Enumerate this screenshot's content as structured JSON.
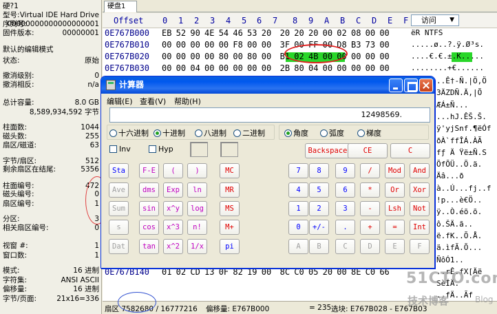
{
  "left_panel": {
    "rows": [
      {
        "label": "硬?1",
        "value": ""
      },
      {
        "label": "型号:",
        "value": "Virtual IDE Hard Drive"
      },
      {
        "label": "序列号:",
        "value": "00000000000000000001"
      },
      {
        "label": "固件版本:",
        "value": "00000001"
      },
      {
        "label": "默认的编辑模式",
        "value": ""
      },
      {
        "label": "状态:",
        "value": "原始"
      },
      {
        "label": "撤消级别:",
        "value": "0"
      },
      {
        "label": "撤消相反:",
        "value": "n/a"
      },
      {
        "label": "总计容量:",
        "value": "8.0 GB"
      },
      {
        "label": "",
        "value": "8,589,934,592 字节"
      },
      {
        "label": "柱面数:",
        "value": "1044"
      },
      {
        "label": "磁头数:",
        "value": "255"
      },
      {
        "label": "扇区/磁道:",
        "value": "63"
      },
      {
        "label": "字节/扇区:",
        "value": "512"
      },
      {
        "label": "剩余扇区在结尾:",
        "value": "5356"
      },
      {
        "label": "柱面编号:",
        "value": "472"
      },
      {
        "label": "磁头编号:",
        "value": "0"
      },
      {
        "label": "扇区编号:",
        "value": "1"
      },
      {
        "label": "分区:",
        "value": "3"
      },
      {
        "label": "相关扇区编号:",
        "value": "0"
      },
      {
        "label": "视窗 #:",
        "value": "1"
      },
      {
        "label": "窗口数:",
        "value": "1"
      },
      {
        "label": "模式:",
        "value": "16 进制"
      },
      {
        "label": "字符集:",
        "value": "ANSI ASCII"
      },
      {
        "label": "偏移量:",
        "value": "16 进制"
      },
      {
        "label": "字节/页面:",
        "value": "21x16=336"
      }
    ]
  },
  "tab": {
    "label": "硬盘1"
  },
  "hex_header": {
    "offset_label": "Offset",
    "columns": [
      "0",
      "1",
      "2",
      "3",
      "4",
      "5",
      "6",
      "7",
      "8",
      "9",
      "A",
      "B",
      "C",
      "D",
      "E",
      "F"
    ],
    "visit_label": "访问"
  },
  "hex_rows": [
    {
      "offset": "0E767B000",
      "bytes": "EB 52 90 4E 54 46 53 20  20 20 20 00 02 08 00 00",
      "ascii": "ëR NTFS"
    },
    {
      "offset": "0E767B010",
      "bytes": "00 00 00 00 00 F8 00 00  3F 00 FF 00 D8 B3 73 00",
      "ascii": ".....ø..?.ÿ.Ø³s."
    },
    {
      "offset": "0E767B020",
      "bytes": "00 00 00 00 80 00 80 00  B1 02 4B 00 00 00 00 00",
      "ascii": "....€.€.±.K....."
    },
    {
      "offset": "0E767B030",
      "bytes": "00 00 04 00 00 00 00 00  2B 80 04 00 00 00 00 00",
      "ascii": "........+€......"
    }
  ],
  "hex_partial_row": {
    "offset": "0E767B140",
    "bytes": "01 02 CD 13 0F 82 19 00  8C C0 05 20 00 8E C0 66"
  },
  "ascii_fragments": [
    "..Ê†-Ñ.|Ö,Ö",
    "3ÄZDÑ.Ä,|Õ",
    "ÆÁ±Ñ...",
    "...hJ.ÊŠ.Š.",
    "ÿ'yjSnf.¶ëÓf",
    "ðÀ`ffÎÁ.ÀÃ",
    "fƒ Ä Ÿë±Ñ.S",
    "ÕfÕÜ..Õ.ä.",
    "Äâ...ð",
    "à..Ú...fj..f",
    "!p...è€Ö..",
    "ÿ..Ò.éõ.õ.",
    "ô.ŠÄ.ã..",
    "ë.fK..Õ.Å.",
    "ä.ìfÃ.Õ...",
    "ÑôÓ1..",
    "..rÊ.fX[Äë",
    "SèÍÄ.",
    "..fÄ..Ãf"
  ],
  "status_bar": {
    "sector": "扇区 7582680 / 16777216",
    "offset": "偏移量: E767B000",
    "value": "= 235",
    "selection": "选块: E767B028 - E767B03"
  },
  "watermark": {
    "big": "51CTO.com",
    "small": "技术博客",
    "blog": "Blog"
  },
  "calculator": {
    "title": "计算器",
    "menu": [
      "编辑(E)",
      "查看(V)",
      "帮助(H)"
    ],
    "display": "12498569.",
    "bases": [
      {
        "label": "十六进制",
        "selected": false
      },
      {
        "label": "十进制",
        "selected": true
      },
      {
        "label": "八进制",
        "selected": false
      },
      {
        "label": "二进制",
        "selected": false
      }
    ],
    "angles": [
      {
        "label": "角度",
        "selected": true
      },
      {
        "label": "弧度",
        "selected": false
      },
      {
        "label": "梯度",
        "selected": false
      }
    ],
    "checkboxes": [
      "Inv",
      "Hyp"
    ],
    "top_buttons": [
      "Backspace",
      "CE",
      "C"
    ],
    "col_a": [
      "Sta",
      "Ave",
      "Sum",
      "s",
      "Dat"
    ],
    "col_b": [
      "F-E",
      "dms",
      "sin",
      "cos",
      "tan"
    ],
    "col_c": [
      "(",
      "Exp",
      "x^y",
      "x^3",
      "x^2"
    ],
    "col_d": [
      ")",
      "ln",
      "log",
      "n!",
      "1/x"
    ],
    "col_e": [
      "MC",
      "MR",
      "MS",
      "M+",
      "pi"
    ],
    "numpad": [
      [
        "7",
        "8",
        "9",
        "/",
        "Mod",
        "And"
      ],
      [
        "4",
        "5",
        "6",
        "*",
        "Or",
        "Xor"
      ],
      [
        "1",
        "2",
        "3",
        "-",
        "Lsh",
        "Not"
      ],
      [
        "0",
        "+/-",
        ".",
        "+",
        "=",
        "Int"
      ],
      [
        "A",
        "B",
        "C",
        "D",
        "E",
        "F"
      ]
    ]
  },
  "colors": {
    "highlight": "#29d629",
    "titlebar": "#0058ee",
    "annotation_red": "#e02020",
    "annotation_blue": "#3050d0"
  }
}
